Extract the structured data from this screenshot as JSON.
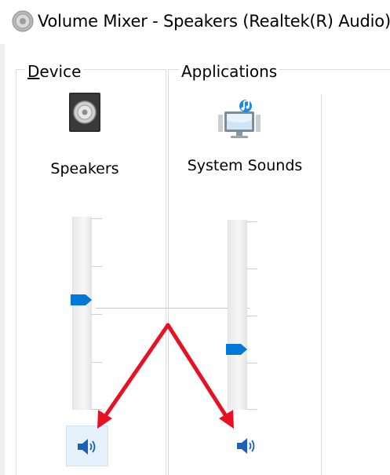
{
  "window": {
    "title": "Volume Mixer - Speakers (Realtek(R) Audio)",
    "title_icon": "speaker-icon"
  },
  "device": {
    "group_label_accel": "D",
    "group_label_rest": "evice",
    "name": "Speakers",
    "icon": "speaker-device-icon",
    "volume_level": 0.57,
    "mute_icon": "speaker-volume-icon",
    "muted": false
  },
  "applications": {
    "group_label": "Applications",
    "items": [
      {
        "name": "System Sounds",
        "icon": "system-sounds-icon",
        "volume_level": 0.32,
        "mute_icon": "speaker-volume-icon",
        "muted": false
      }
    ]
  },
  "colors": {
    "accent": "#0078d7",
    "annotation_arrow": "#e81123"
  }
}
